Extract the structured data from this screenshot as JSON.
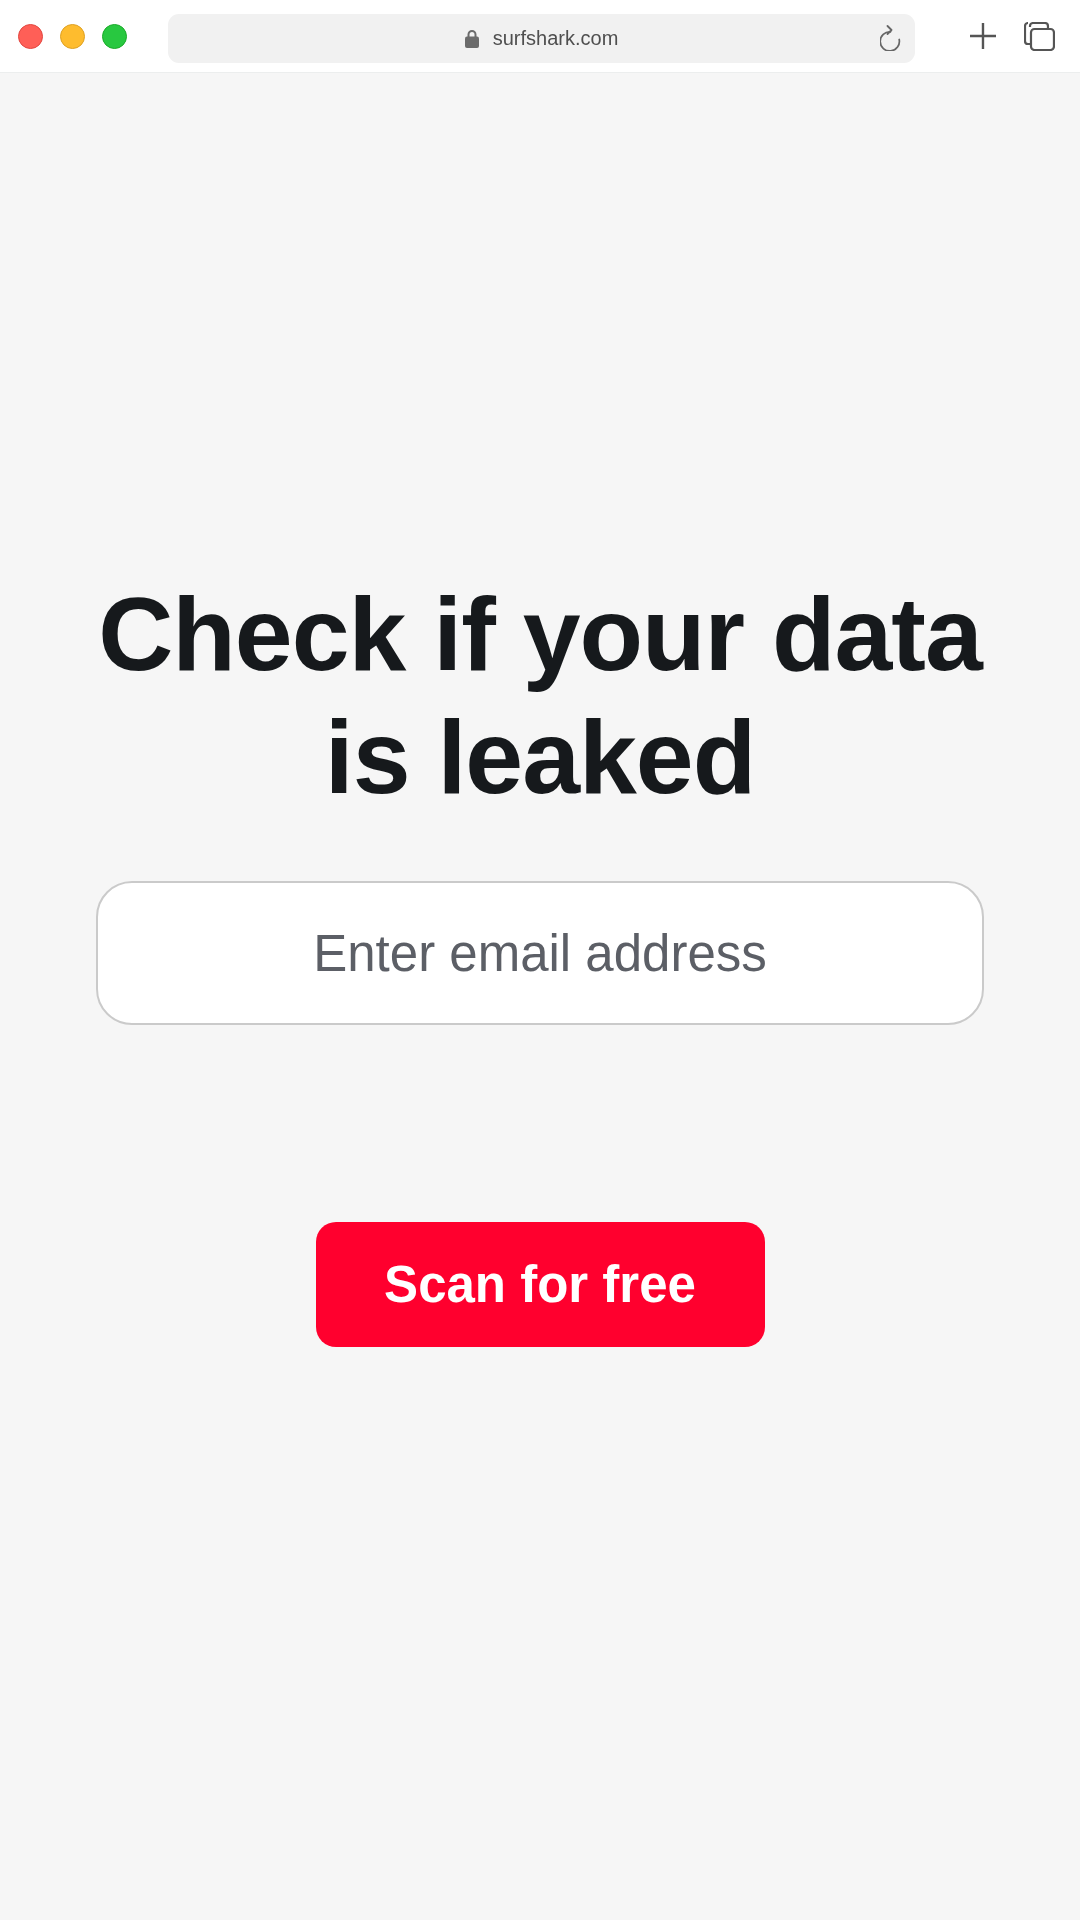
{
  "browser": {
    "url": "surfshark.com"
  },
  "page": {
    "heading": "Check if your data is leaked",
    "email_field": {
      "placeholder": "Enter email address"
    },
    "scan_button": {
      "label": "Scan for free"
    }
  }
}
